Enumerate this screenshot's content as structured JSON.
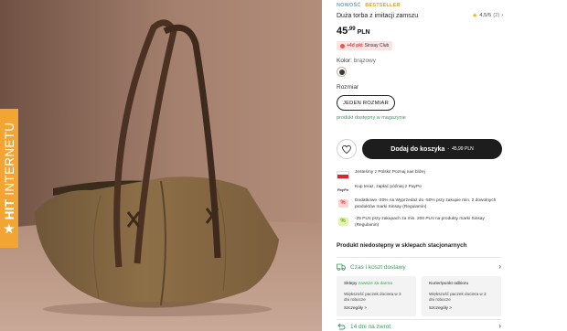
{
  "badge": {
    "bold": "HIT",
    "regular": "INTERNETU"
  },
  "product": {
    "tag_new": "NOWOŚĆ",
    "tag_bestseller": "BESTSELLER",
    "title": "Duża torba z imitacji zamszu",
    "rating": {
      "score": "4,5/5",
      "count": "(2)",
      "stars": 4.5
    },
    "price": {
      "main": "45",
      "cents": ",99",
      "currency": "PLN"
    },
    "club": {
      "pct": "+4d pkt",
      "label": "Sinsay Club"
    },
    "color": {
      "label": "Kolor:",
      "value": "brązowy",
      "swatch": "#4c3526"
    },
    "size": {
      "label": "Rozmiar",
      "option": "JEDEN ROZMIAR"
    },
    "availability_link": "produkt dostępny w magazynie"
  },
  "actions": {
    "favourite_icon": "heart-icon",
    "cart_label": "Dodaj do koszyka",
    "cart_sep": "-",
    "cart_price": "45,99 PLN"
  },
  "benefits": [
    {
      "icon": "poland-flag",
      "text": "Jesteśmy z Polski! Poznaj nas bliżej"
    },
    {
      "icon": "paypo-logo",
      "logo": "PayPo",
      "text": "Kup teraz, zapłać później z PayPo"
    },
    {
      "icon": "percent-icon",
      "text": "Dodatkowe -20% na Wyprzedaż do -50% przy zakupie min. 2 dowolnych produktów marki Sinsay (Regulamin)"
    },
    {
      "icon": "percent-icon",
      "text": "-25 PLN przy zakupach za min. 200 PLN na produkty marki Sinsay (Regulamin)"
    }
  ],
  "store_note": "Produkt niedostępny w sklepach stacjonarnych",
  "delivery": {
    "title": "Czas i koszt dostawy",
    "stores": {
      "head": "Sklepy",
      "free": "zawsze za darmo",
      "desc_line1": "Większość paczek dociera w 3",
      "desc_line2": "dni robocze",
      "link": "Szczegóły >"
    },
    "courier": {
      "head": "Kurier/punkt odbioru",
      "desc_line1": "Większość paczek dociera w 3",
      "desc_line2": "dni robocze",
      "link": "Szczegóły >"
    }
  },
  "returns": {
    "title": "14 dni na zwrot"
  },
  "colors": {
    "accent_green": "#3a9b5b",
    "badge_orange": "#f2a533",
    "cart_bg": "#1d1d1d"
  }
}
